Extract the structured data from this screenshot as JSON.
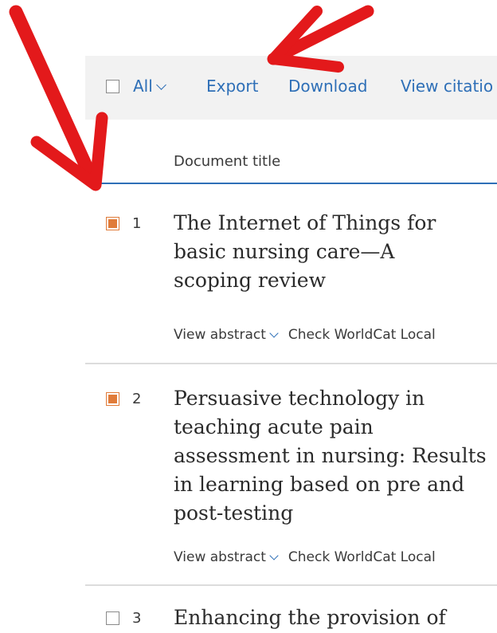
{
  "toolbar": {
    "select_all_label": "All",
    "export_label": "Export",
    "download_label": "Download",
    "view_citation_label": "View citatio"
  },
  "table": {
    "column_header": "Document title"
  },
  "results": [
    {
      "number": "1",
      "checked": true,
      "title_lines": [
        "The Internet of Things for",
        "basic nursing care—A",
        "scoping review"
      ],
      "view_abstract": "View abstract",
      "check_worldcat": "Check WorldCat Local"
    },
    {
      "number": "2",
      "checked": true,
      "title_lines": [
        "Persuasive technology in",
        "teaching acute pain",
        "assessment in nursing: Results",
        "in learning based on pre and",
        "post-testing"
      ],
      "view_abstract": "View abstract",
      "check_worldcat": "Check WorldCat Local"
    },
    {
      "number": "3",
      "checked": false,
      "title_lines": [
        "Enhancing the provision of"
      ]
    }
  ],
  "colors": {
    "link": "#2e6fb7",
    "checked": "#e07b39",
    "annotation_arrow": "#e3191b"
  },
  "annotations": {
    "arrows": [
      "arrow-to-select-checkbox",
      "arrow-to-export-toolbar"
    ]
  }
}
